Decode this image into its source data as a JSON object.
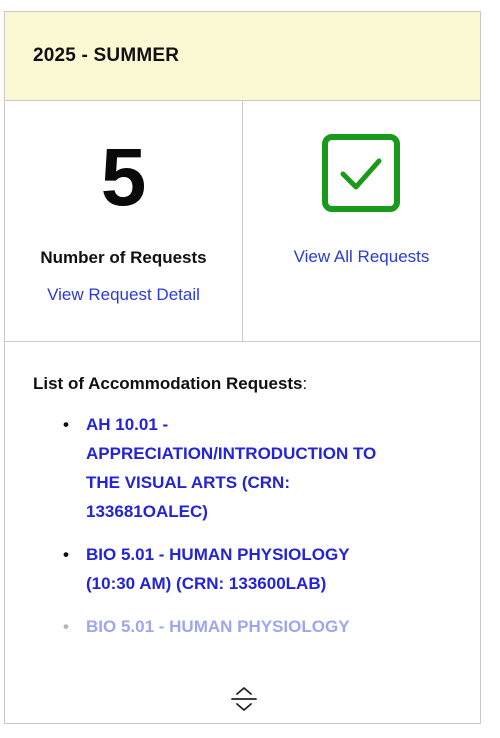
{
  "header": {
    "term": "2025 - SUMMER"
  },
  "stats": {
    "request_count": "5",
    "count_label": "Number of Requests",
    "detail_link": "View Request Detail",
    "all_link": "View All Requests",
    "check_color": "#1a9a1a"
  },
  "list": {
    "title": "List of Accommodation Requests",
    "title_suffix": ":",
    "items": [
      {
        "label": "AH 10.01 - APPRECIATION/INTRODUCTION TO THE VISUAL ARTS (CRN: 133681OALEC)"
      },
      {
        "label": "BIO 5.01 - HUMAN PHYSIOLOGY (10:30 AM) (CRN: 133600LAB)"
      },
      {
        "label": "BIO 5.01 - HUMAN PHYSIOLOGY"
      }
    ]
  },
  "colors": {
    "header_bg": "#fbf8d4",
    "link": "#2b3bd6",
    "course_link": "#2323d8",
    "border": "#c9c9c9"
  },
  "icons": {
    "check": "check-square-icon",
    "expand": "expand-collapse-icon"
  }
}
